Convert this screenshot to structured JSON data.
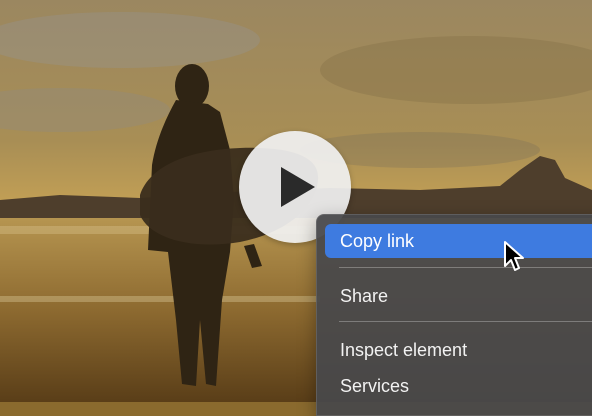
{
  "video": {
    "description_icon": "play-icon"
  },
  "context_menu": {
    "items": [
      {
        "label": "Copy link",
        "highlighted": true
      },
      {
        "label": "Share"
      },
      {
        "label": "Inspect element"
      },
      {
        "label": "Services"
      }
    ]
  },
  "colors": {
    "highlight": "#3e7be0",
    "menu_background": "#48484a"
  }
}
